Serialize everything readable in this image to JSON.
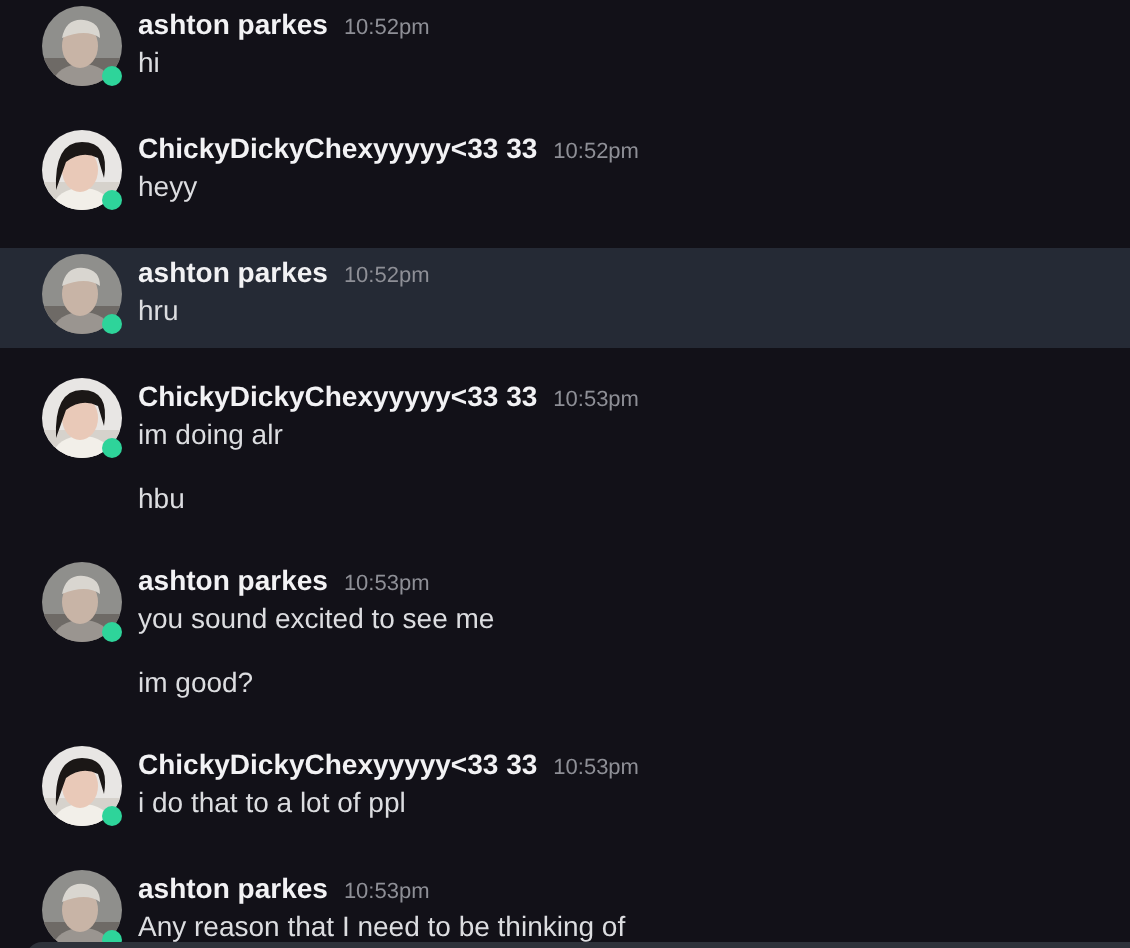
{
  "messages": [
    {
      "author": "ashton parkes",
      "time": "10:52pm",
      "online": true,
      "highlighted": false,
      "lines": [
        "hi"
      ]
    },
    {
      "author": "ChickyDickyChexyyyyy<33 33",
      "time": "10:52pm",
      "online": true,
      "highlighted": false,
      "lines": [
        "heyy"
      ]
    },
    {
      "author": "ashton parkes",
      "time": "10:52pm",
      "online": true,
      "highlighted": true,
      "lines": [
        "hru"
      ]
    },
    {
      "author": "ChickyDickyChexyyyyy<33 33",
      "time": "10:53pm",
      "online": true,
      "highlighted": false,
      "lines": [
        "im doing alr",
        "hbu"
      ]
    },
    {
      "author": "ashton parkes",
      "time": "10:53pm",
      "online": true,
      "highlighted": false,
      "lines": [
        "you sound excited to see me",
        "im good?"
      ]
    },
    {
      "author": "ChickyDickyChexyyyyy<33 33",
      "time": "10:53pm",
      "online": true,
      "highlighted": false,
      "lines": [
        "i do that to a lot of ppl"
      ]
    },
    {
      "author": "ashton parkes",
      "time": "10:53pm",
      "online": true,
      "highlighted": false,
      "lines": [
        "Any reason that I need to be thinking of"
      ]
    }
  ]
}
